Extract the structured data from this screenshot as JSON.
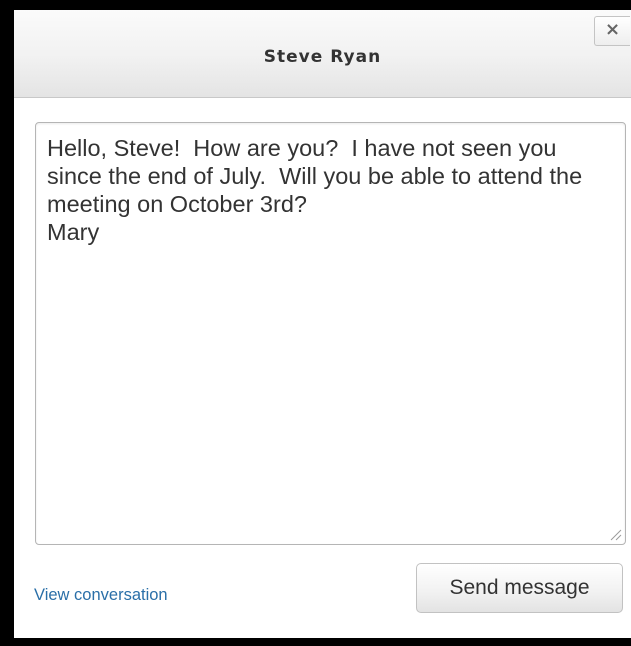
{
  "dialog": {
    "title": "Steve Ryan",
    "close_label": "×"
  },
  "message": {
    "text": "Hello, Steve!  How are you?  I have not seen you since the end of July.  Will you be able to attend the meeting on October 3rd?\nMary"
  },
  "footer": {
    "view_conversation_label": "View conversation",
    "send_label": "Send message"
  },
  "colors": {
    "link": "#2a6fa8",
    "frame": "#000000"
  }
}
